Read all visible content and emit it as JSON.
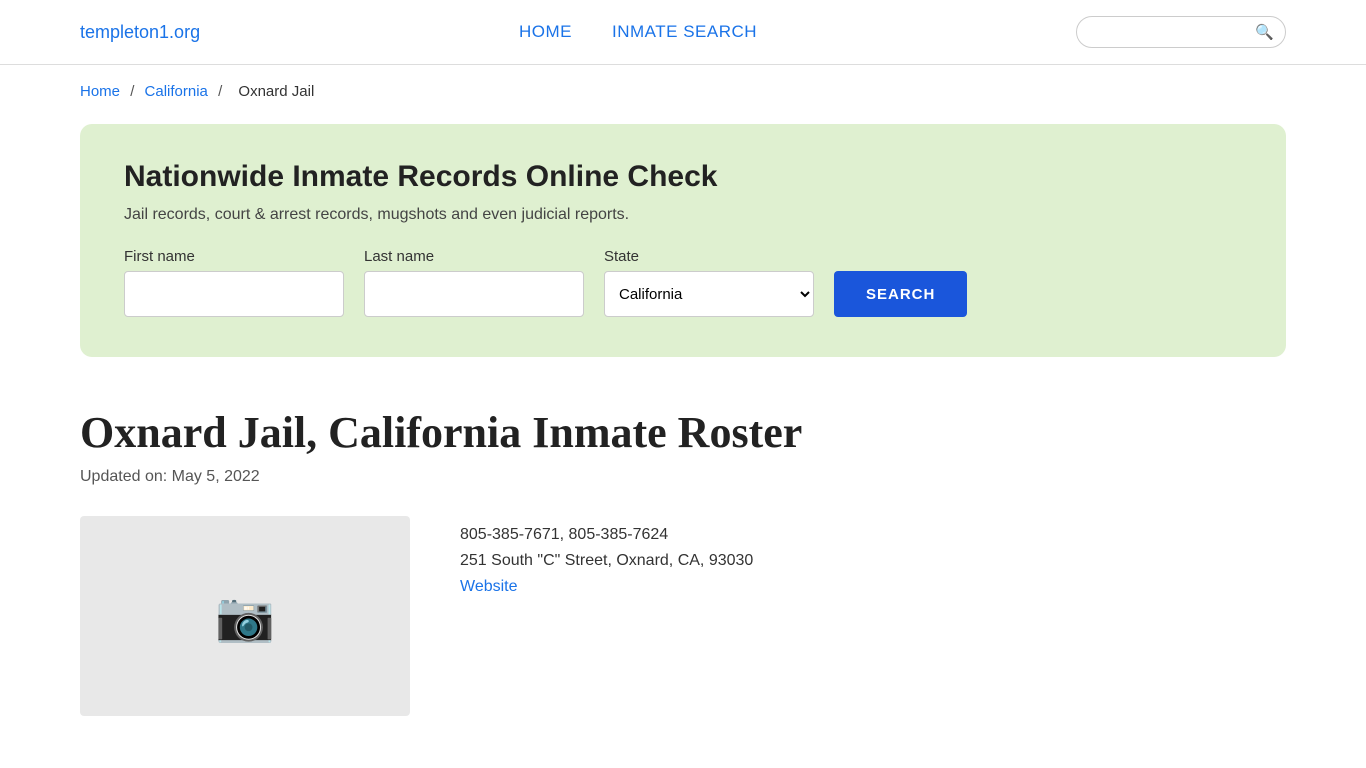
{
  "header": {
    "logo": "templeton1.org",
    "nav": {
      "home": "HOME",
      "inmate_search": "INMATE SEARCH"
    },
    "search_placeholder": ""
  },
  "breadcrumb": {
    "home": "Home",
    "separator1": "/",
    "california": "California",
    "separator2": "/",
    "current": "Oxnard Jail"
  },
  "search_panel": {
    "title": "Nationwide Inmate Records Online Check",
    "description": "Jail records, court & arrest records, mugshots and even judicial reports.",
    "first_name_label": "First name",
    "last_name_label": "Last name",
    "state_label": "State",
    "state_value": "California",
    "button_label": "SEARCH"
  },
  "main": {
    "page_title": "Oxnard Jail, California Inmate Roster",
    "updated_label": "Updated on: May 5, 2022",
    "jail_phone": "805-385-7671, 805-385-7624",
    "jail_address": "251 South \"C\" Street, Oxnard, CA, 93030",
    "jail_website": "Website"
  },
  "icons": {
    "search": "🔍",
    "camera": "📷"
  }
}
